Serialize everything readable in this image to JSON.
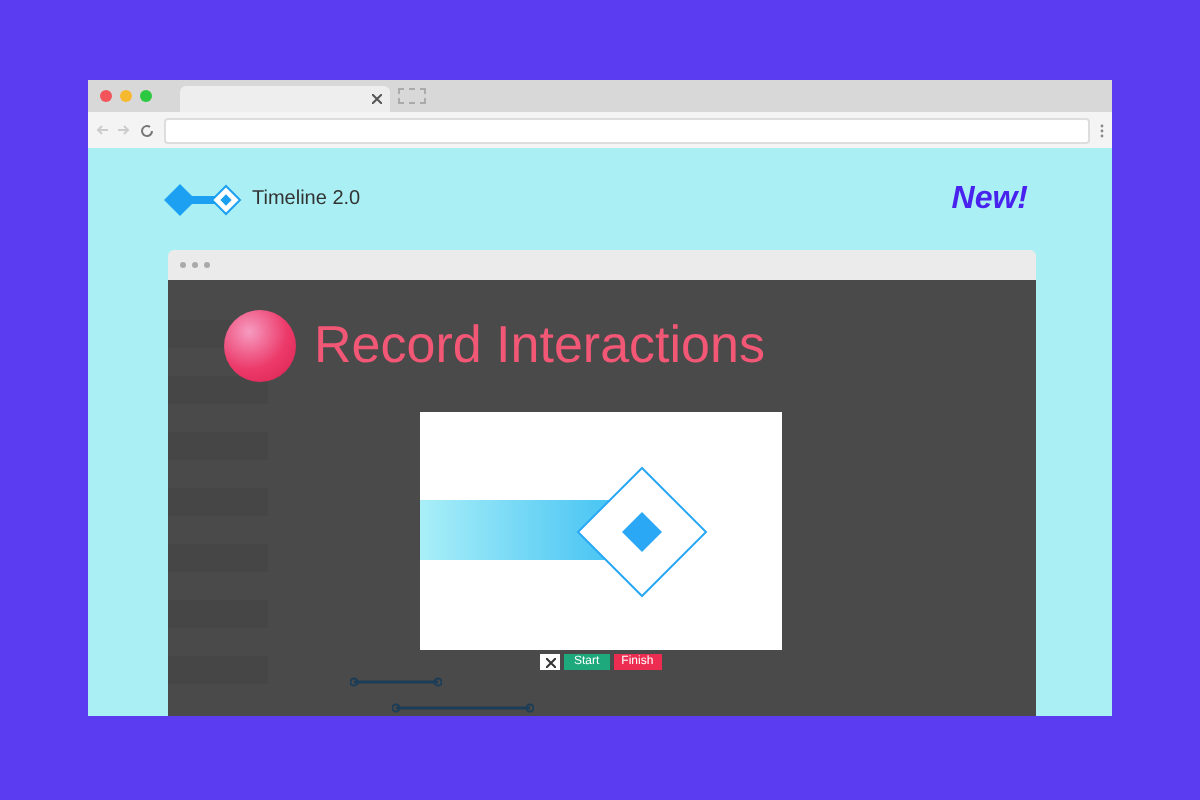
{
  "brand": {
    "name": "Timeline 2.0",
    "badge": "New!"
  },
  "app": {
    "heading": "Record Interactions",
    "controls": [
      {
        "kind": "close"
      },
      {
        "kind": "start",
        "label": "Start"
      },
      {
        "kind": "finish",
        "label": "Finish"
      }
    ]
  }
}
